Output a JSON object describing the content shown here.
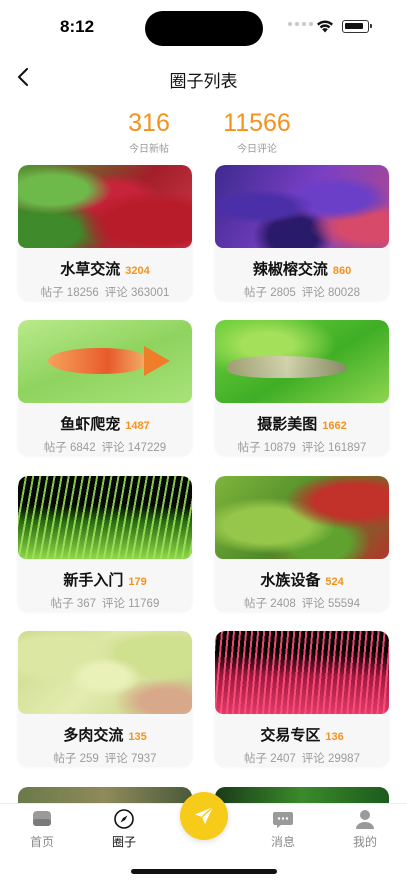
{
  "status": {
    "time": "8:12"
  },
  "nav": {
    "title": "圈子列表"
  },
  "stats": [
    {
      "value": "316",
      "label": "今日新帖"
    },
    {
      "value": "11566",
      "label": "今日评论"
    }
  ],
  "cards": [
    {
      "name": "水草交流",
      "count": "3204",
      "posts": "帖子 18256",
      "comments": "评论 363001",
      "image": "red-green-plants"
    },
    {
      "name": "辣椒榕交流",
      "count": "860",
      "posts": "帖子 2805",
      "comments": "评论 80028",
      "image": "purple-leaves"
    },
    {
      "name": "鱼虾爬宠",
      "count": "1487",
      "posts": "帖子 6842",
      "comments": "评论 147229",
      "image": "orange-fish"
    },
    {
      "name": "摄影美图",
      "count": "1662",
      "posts": "帖子 10879",
      "comments": "评论 161897",
      "image": "shrimp"
    },
    {
      "name": "新手入门",
      "count": "179",
      "posts": "帖子 367",
      "comments": "评论 11769",
      "image": "green-grass"
    },
    {
      "name": "水族设备",
      "count": "524",
      "posts": "帖子 2408",
      "comments": "评论 55594",
      "image": "aquascape"
    },
    {
      "name": "多肉交流",
      "count": "135",
      "posts": "帖子 259",
      "comments": "评论 7937",
      "image": "succulent"
    },
    {
      "name": "交易专区",
      "count": "136",
      "posts": "帖子 2407",
      "comments": "评论 29987",
      "image": "pink-grass"
    }
  ],
  "tabbar": {
    "home": "首页",
    "circle": "圈子",
    "messages": "消息",
    "mine": "我的",
    "active": "circle"
  },
  "colors": {
    "accent": "#f4921e",
    "fab": "#f7cb1a"
  }
}
